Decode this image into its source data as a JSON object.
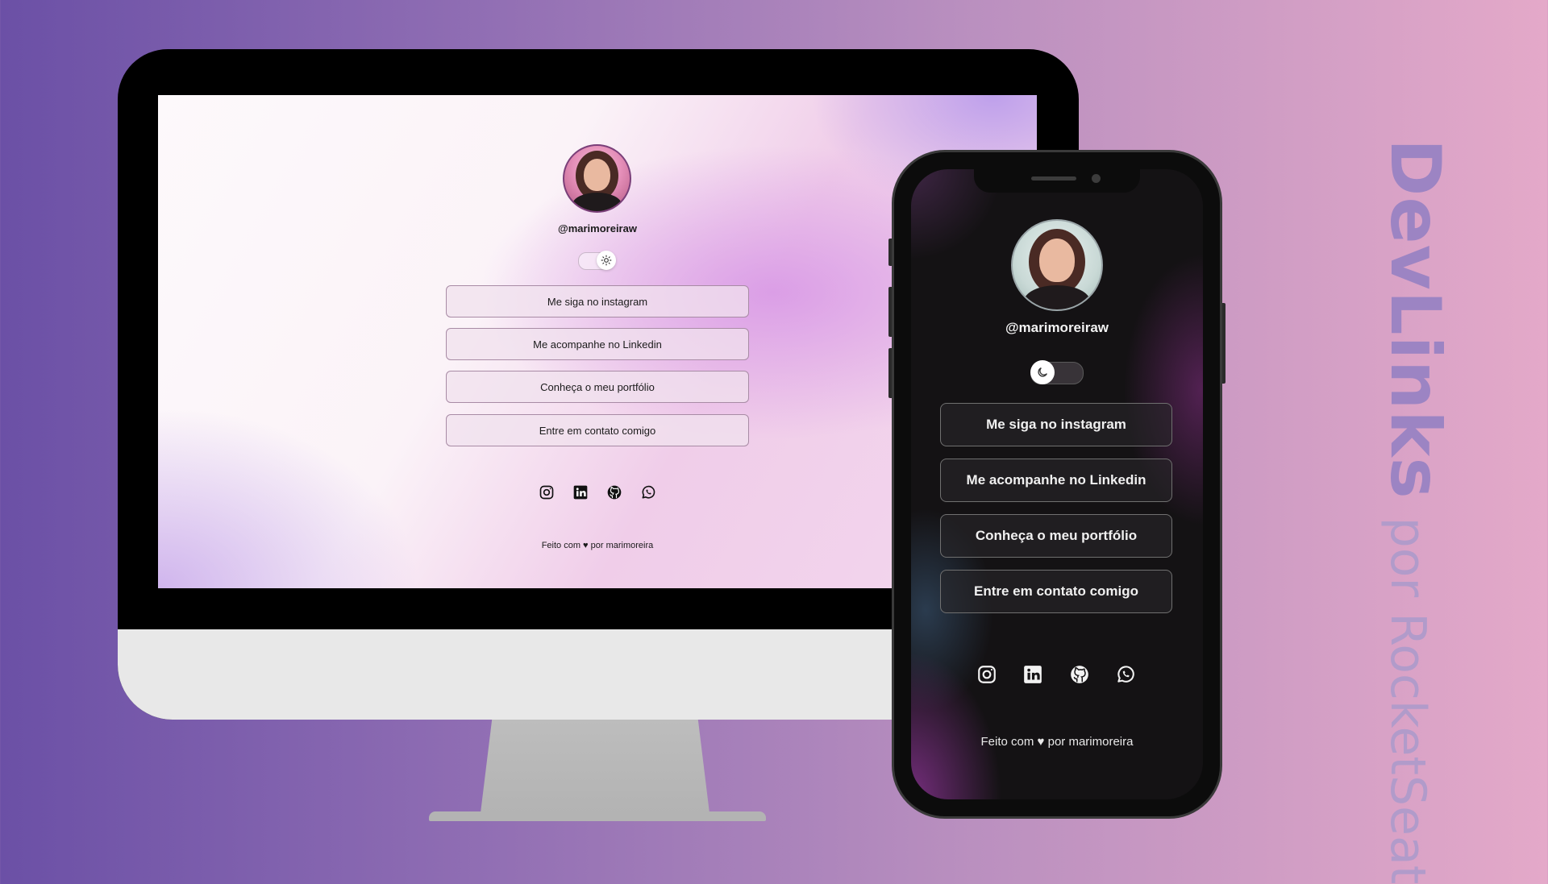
{
  "desktop": {
    "username": "@marimoreiraw",
    "theme_toggle": {
      "mode": "light",
      "icon": "sun-icon"
    },
    "links": [
      {
        "label": "Me siga no instagram"
      },
      {
        "label": "Me acompanhe no Linkedin"
      },
      {
        "label": "Conheça o meu portfólio"
      },
      {
        "label": "Entre em contato comigo"
      }
    ],
    "socials": [
      "instagram-icon",
      "linkedin-icon",
      "github-icon",
      "whatsapp-icon"
    ],
    "footer": "Feito com ♥ por marimoreira"
  },
  "mobile": {
    "username": "@marimoreiraw",
    "theme_toggle": {
      "mode": "dark",
      "icon": "moon-icon"
    },
    "links": [
      {
        "label": "Me siga no instagram"
      },
      {
        "label": "Me acompanhe no Linkedin"
      },
      {
        "label": "Conheça o meu portfólio"
      },
      {
        "label": "Entre em contato comigo"
      }
    ],
    "socials": [
      "instagram-icon",
      "linkedin-icon",
      "github-icon",
      "whatsapp-icon"
    ],
    "footer": "Feito com ♥ por marimoreira"
  },
  "promo": {
    "title": "DevLinks",
    "byline": "por RocketSeat"
  },
  "colors": {
    "background_start": "#6b50a6",
    "background_end": "#e4a9c9",
    "title_text": "#9c84c3"
  }
}
